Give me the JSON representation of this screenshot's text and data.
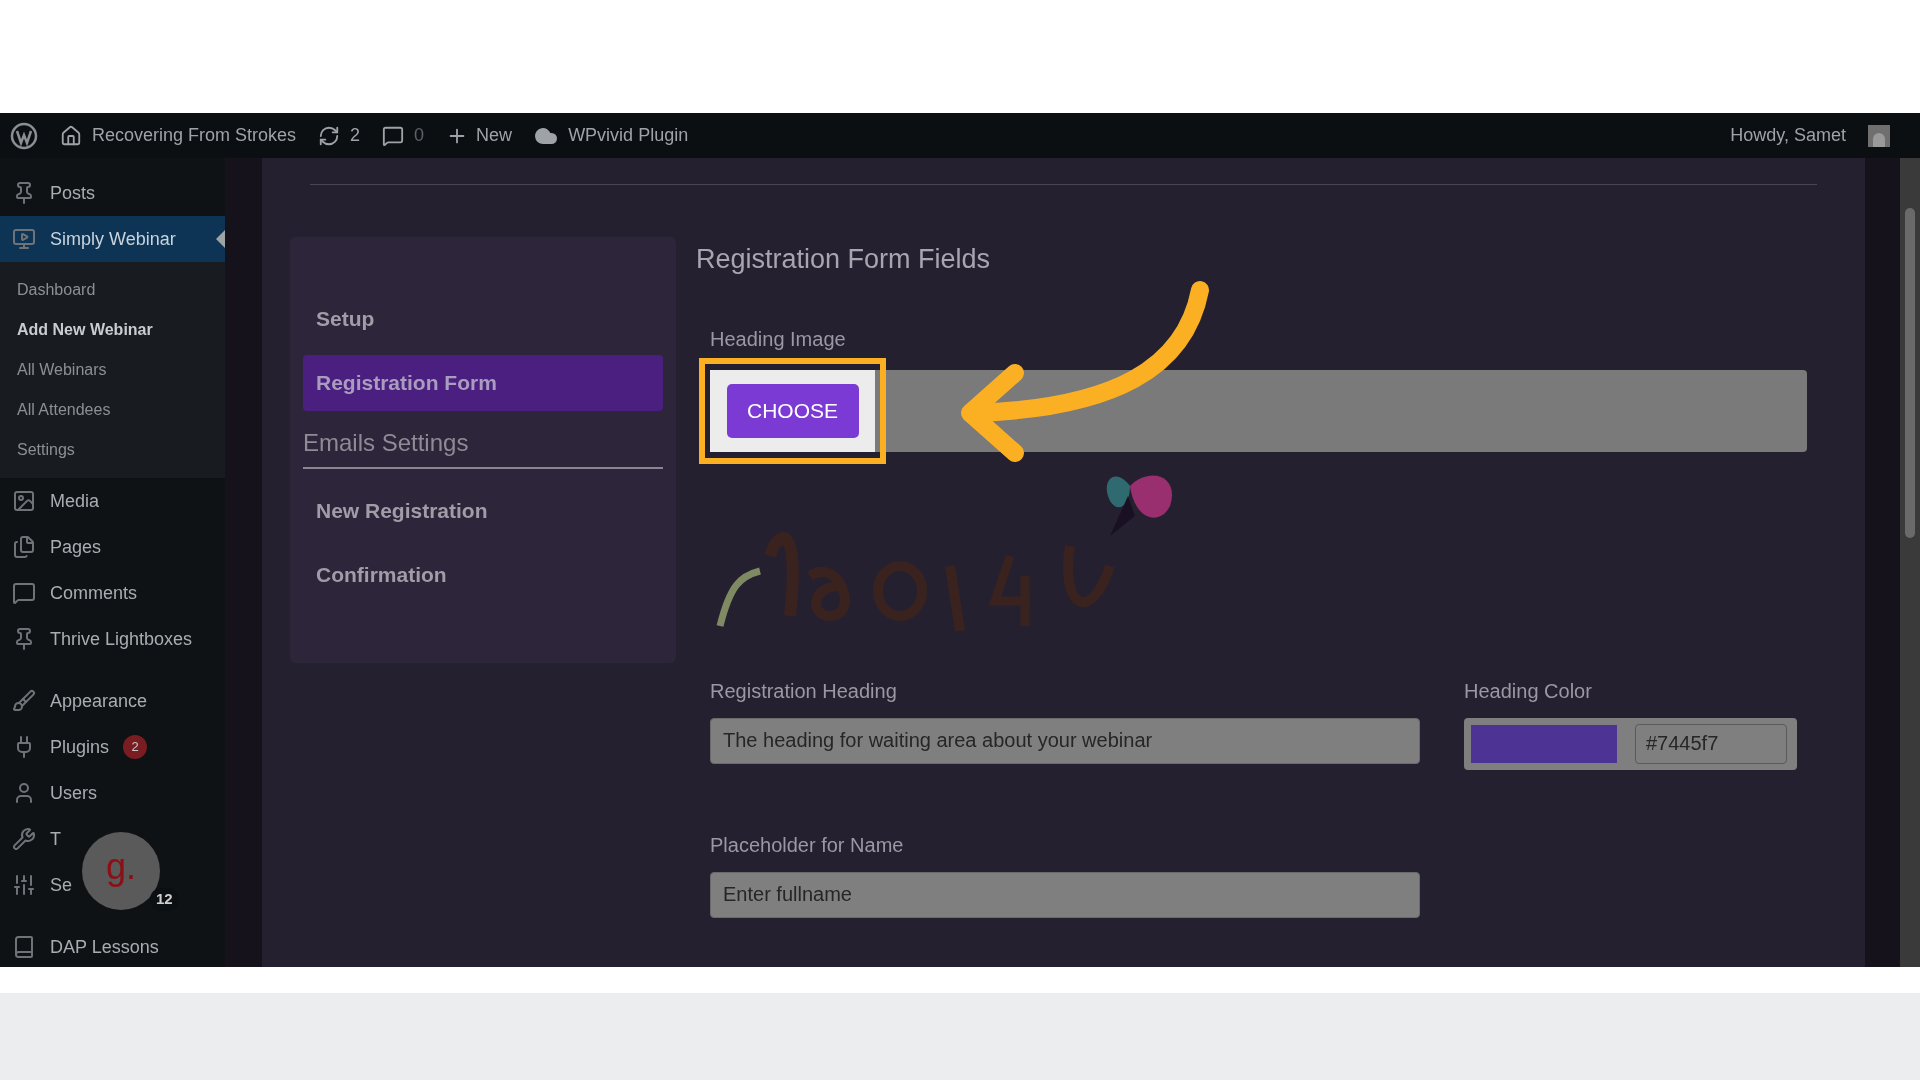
{
  "admin_bar": {
    "site": "Recovering From Strokes",
    "updates": "2",
    "comments": "0",
    "new": "New",
    "plugin": "WPvivid Plugin",
    "greeting": "Howdy, Samet"
  },
  "sidebar": {
    "items": [
      {
        "label": "Posts",
        "selected": false
      },
      {
        "label": "Simply Webinar",
        "selected": true,
        "children": [
          {
            "label": "Dashboard",
            "selected": false
          },
          {
            "label": "Add New Webinar",
            "selected": true
          },
          {
            "label": "All Webinars",
            "selected": false
          },
          {
            "label": "All Attendees",
            "selected": false
          },
          {
            "label": "Settings",
            "selected": false
          }
        ]
      },
      {
        "label": "Media",
        "selected": false
      },
      {
        "label": "Pages",
        "selected": false
      },
      {
        "label": "Comments",
        "selected": false
      },
      {
        "label": "Thrive Lightboxes",
        "selected": false
      },
      {
        "label": "Appearance",
        "selected": false
      },
      {
        "label": "Plugins",
        "selected": false,
        "badge": "2"
      },
      {
        "label": "Users",
        "selected": false
      },
      {
        "label": "T",
        "selected": false
      },
      {
        "label": "Se",
        "selected": false
      },
      {
        "label": "DAP Lessons",
        "selected": false
      }
    ]
  },
  "widget": {
    "logo": "g.",
    "count": "12"
  },
  "settings_nav": {
    "items": [
      {
        "kind": "link",
        "label": "Setup",
        "selected": false
      },
      {
        "kind": "link",
        "label": "Registration Form",
        "selected": true
      },
      {
        "kind": "heading",
        "label": "Emails Settings"
      },
      {
        "kind": "link",
        "label": "New Registration",
        "selected": false
      },
      {
        "kind": "link",
        "label": "Confirmation",
        "selected": false
      }
    ]
  },
  "form": {
    "title": "Registration Form Fields",
    "heading_image": {
      "label": "Heading Image",
      "button": "CHOOSE"
    },
    "registration_heading": {
      "label": "Registration Heading",
      "placeholder": "The heading for waiting area about your webinar"
    },
    "heading_color": {
      "label": "Heading Color",
      "value": "#7445f7"
    },
    "name_placeholder": {
      "label": "Placeholder for Name",
      "value": "Enter fullname"
    }
  }
}
